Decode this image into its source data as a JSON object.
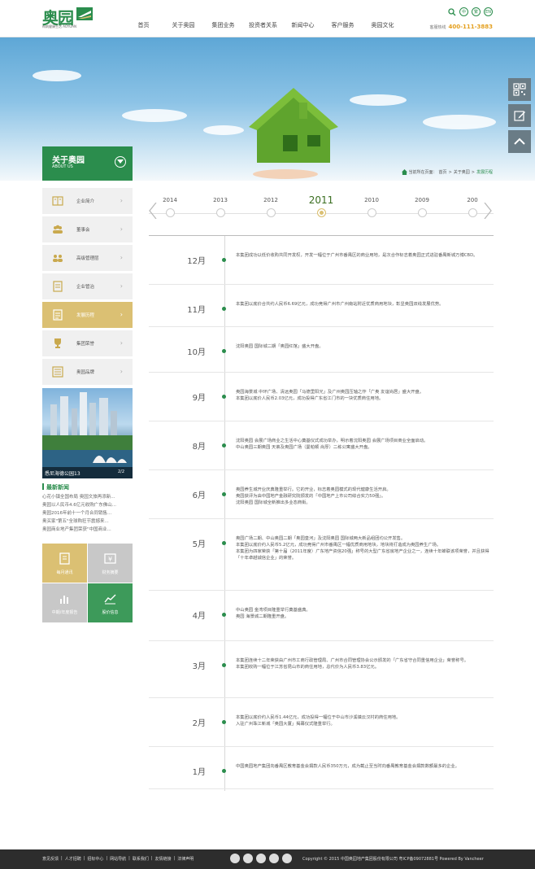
{
  "header": {
    "logo_text": "奥园",
    "logo_sub": "构筑健康生活 AOYUAN",
    "nav": [
      "首页",
      "关于奥园",
      "集团业务",
      "投资者关系",
      "新闻中心",
      "客户服务",
      "奥园文化"
    ],
    "lang": [
      "中",
      "繁",
      "EN"
    ],
    "hotline_label": "客服热线",
    "hotline": "400-111-3883"
  },
  "breadcrumb": {
    "prefix": "当前所在页面：",
    "items": [
      "首页",
      "关于奥园"
    ],
    "current": "发展历程",
    "sep": ">"
  },
  "sidebar": {
    "title": "关于奥园",
    "subtitle": "ABOUT US",
    "items": [
      {
        "label": "企业简介",
        "icon": "book-icon"
      },
      {
        "label": "董事会",
        "icon": "group-icon"
      },
      {
        "label": "高级管理层",
        "icon": "team-icon"
      },
      {
        "label": "企业管治",
        "icon": "document-icon"
      },
      {
        "label": "发展历程",
        "icon": "history-icon"
      },
      {
        "label": "集团荣誉",
        "icon": "trophy-icon"
      },
      {
        "label": "奥园品牌",
        "icon": "brand-icon"
      }
    ],
    "active_index": 4,
    "photo_caption": "悉尼海德公园13",
    "photo_page": "2/2",
    "news_title": "最新新闻",
    "news": [
      "心花小镇全国布局 奥园文旅再添新...",
      "奥园以人民币4.6亿元收购广东佛山...",
      "奥园2016年前十一个月合同销售...",
      "奥买家\"第五\"全球购狂节震撼来...",
      "奥园商业地产集团荣获\"中国商业..."
    ],
    "tiles": [
      {
        "label": "每月通讯",
        "color": "#dbc073",
        "icon": "newsletter-icon"
      },
      {
        "label": "财务摘要",
        "color": "#c8c8c8",
        "icon": "finance-icon"
      },
      {
        "label": "中期/年度报告",
        "color": "#c8c8c8",
        "icon": "chart-icon"
      },
      {
        "label": "股价信息",
        "color": "#3d9a5a",
        "icon": "stock-icon"
      }
    ]
  },
  "timeline": {
    "years": [
      "2014",
      "2013",
      "2012",
      "2011",
      "2010",
      "2009",
      "200"
    ],
    "active_year": "2011",
    "months": [
      {
        "month": "12月",
        "text": [
          "本集团成功以低价收购共同开发权，开发一幅位于广州市番禺区的商业用地，是次合作标志着奥园正式进驻番禺新城万博CBD。"
        ]
      },
      {
        "month": "11月",
        "text": [
          "本集团以底价合共约人民币6.69亿元，成功竞得广州市广州南站附近优质商用地块，彰显奥园双线发展优势。"
        ]
      },
      {
        "month": "10月",
        "text": [
          "沈阳奥园 国际城二期「奥园红馆」盛大开盘。"
        ]
      },
      {
        "month": "9月",
        "text": [
          "奥园海景城 中环广场、清远奥园「马德里阳光」及广州奥园压轴之作「广奥 友谊尚居」盛大开盘。",
          "本集团以底价人民币2.03亿元，成功投得广东省江门市的一块优质商住用地。"
        ]
      },
      {
        "month": "8月",
        "text": [
          "沈阳奥园 会展广场商业之生活中心奠基仪式成功举办，明示着沈阳奥园 会展广场项目商业全面启动。",
          "中山奥园三期奥园 天荟及奥园广场（曼帕顿 尚厚）二栋公寓盛大开盘。"
        ]
      },
      {
        "month": "6月",
        "text": [
          "奥园养生城开业庆典隆重举行。它的开业，标志着奥园模式的现代健康生活开启。",
          "奥园获评为由中国地产金融研究院颁发的「中国地产上市公司综合实力50强」。",
          "沈阳奥园 国际城全新推出多业态商街。"
        ]
      },
      {
        "month": "5月",
        "text": [
          "奥园广场二期、中山奥园二期「奥园皇河」及沈阳奥园 国际城两大新品组团均公开发售。",
          "本集团以底价约人民币5.2亿元，成功竞得广州市番禺区一幅优质商用地块，地块将打造成为奥园养生广场。",
          "本集团为四家荣获「第十届（2011年度）广东地产资信20强」称号的大型广东省房地产企业之一，连续十年蝉联该项荣誉，并且获得「十年卓越诚信企业」的荣誉。"
        ]
      },
      {
        "month": "4月",
        "text": [
          "中山奥园 金湾项目隆重举行奠基盛典。",
          "奥园 海景城二期隆重开盘。"
        ]
      },
      {
        "month": "3月",
        "text": [
          "本集团连续十二年荣获由广州市工商行政管理局、广州市合同管理协会公示颁发的「广东省守合同重信用企业」荣誉称号。",
          "本集团收购一幅位于江苏省昆山市的商住用地，总代价为人民币3.83亿元。"
        ]
      },
      {
        "month": "2月",
        "text": [
          "本集团以底价约人民币1.44亿元，成功投得一幅位于中山市沙溪镇云汉村的商住用地。",
          "入驻广州珠江新城「奥园大厦」揭幕仪式隆重举行。"
        ]
      },
      {
        "month": "1月",
        "text": [
          "中国奥园地产集团向番禺区教育基金会捐款人民币350万元，成为截止至当时向番禺教育基金会捐款数额最多的企业。"
        ]
      }
    ]
  },
  "footer": {
    "links": [
      "意见反馈",
      "人才招聘",
      "招标中心",
      "网站导航",
      "联系我们",
      "友情链接",
      "法律声明"
    ],
    "sep": "|",
    "copyright": "Copyright © 2015 中国奥园地产集团股份有限公司 粤ICP备09072881号 Powered By Vancheer"
  },
  "colors": {
    "brand": "#2b8d4d",
    "gold": "#dbc073",
    "hotline": "#e4a020",
    "footer": "#2d2d2d"
  }
}
